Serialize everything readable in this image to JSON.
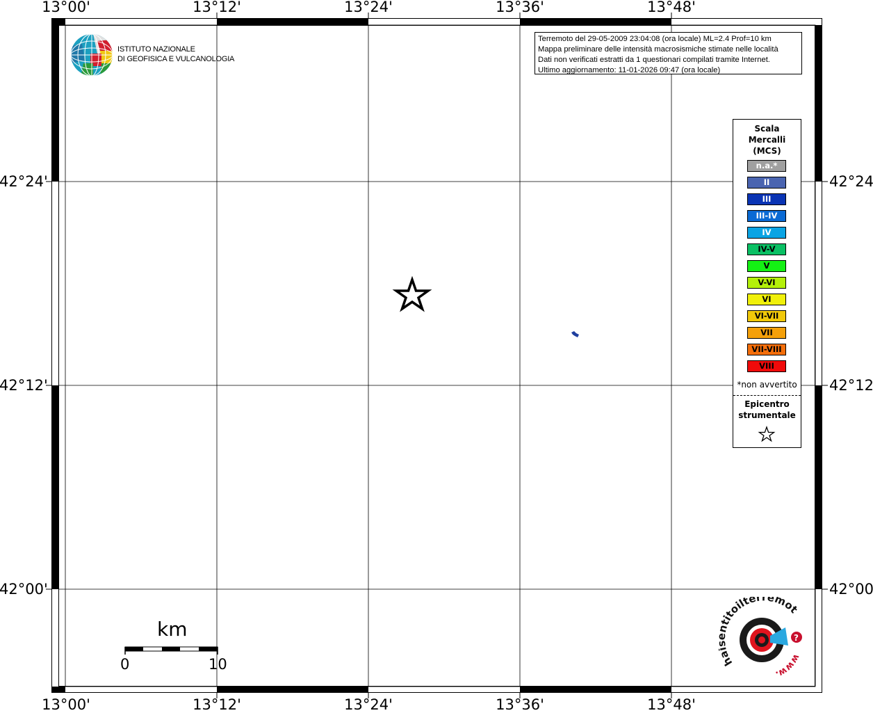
{
  "map": {
    "top_labels": [
      "13°00'",
      "13°12'",
      "13°24'",
      "13°36'",
      "13°48'"
    ],
    "bottom_labels": [
      "13°00'",
      "13°12'",
      "13°24'",
      "13°36'",
      "13°48'"
    ],
    "left_labels": [
      "42°24'",
      "42°12'",
      "42°00'"
    ],
    "right_labels": [
      "42°24'",
      "42°12'",
      "42°00'"
    ],
    "epicenter": {
      "lon": 13.455,
      "lat": 42.25
    },
    "lake": {
      "lon": 13.683,
      "lat": 42.225
    }
  },
  "info": {
    "line1": "Terremoto del 29-05-2009 23:04:08 (ora locale) ML=2.4 Prof=10 km",
    "line2": "Mappa preliminare delle intensità macrosismiche stimate nelle località",
    "line3": "Dati non verificati estratti da 1 questionari compilati tramite Internet.",
    "line4": "Ultimo aggiornamento: 11-01-2026 09:47 (ora locale)"
  },
  "legend": {
    "title_lines": [
      "Scala",
      "Mercalli",
      "(MCS)"
    ],
    "items": [
      {
        "label": "n.a.*",
        "color": "#a0a0a0",
        "text_color": "#ffffff"
      },
      {
        "label": "II",
        "color": "#4a64b0",
        "text_color": "#ffffff"
      },
      {
        "label": "III",
        "color": "#0a34b4",
        "text_color": "#ffffff"
      },
      {
        "label": "III-IV",
        "color": "#0a6ad4",
        "text_color": "#ffffff"
      },
      {
        "label": "IV",
        "color": "#0aa4e4",
        "text_color": "#ffffff"
      },
      {
        "label": "IV-V",
        "color": "#0ac064",
        "text_color": "#000000"
      },
      {
        "label": "V",
        "color": "#14f014",
        "text_color": "#000000"
      },
      {
        "label": "V-VI",
        "color": "#b4f00a",
        "text_color": "#000000"
      },
      {
        "label": "VI",
        "color": "#f0f00a",
        "text_color": "#000000"
      },
      {
        "label": "VI-VII",
        "color": "#f0c80a",
        "text_color": "#000000"
      },
      {
        "label": "VII",
        "color": "#f4a00a",
        "text_color": "#000000"
      },
      {
        "label": "VII-VIII",
        "color": "#f46e0a",
        "text_color": "#000000"
      },
      {
        "label": "VIII",
        "color": "#f00a0a",
        "text_color": "#000000"
      }
    ],
    "note": "*non avvertito",
    "epicenter_lines": [
      "Epicentro",
      "strumentale"
    ]
  },
  "logos": {
    "ingv_line1": "ISTITUTO NAZIONALE",
    "ingv_line2": "DI GEOFISICA E VULCANOLOGIA",
    "hsit_text": "haisentitoilterremoto.it",
    "hsit_www": "www."
  },
  "scale": {
    "unit": "km",
    "start": "0",
    "end": "10"
  }
}
